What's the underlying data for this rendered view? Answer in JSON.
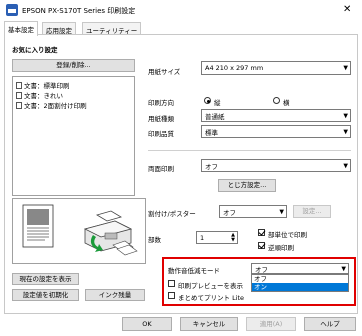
{
  "window": {
    "title": "EPSON PX-S170T Series 印刷設定",
    "close_glyph": "✕"
  },
  "tabs": [
    {
      "label": "基本設定",
      "active": true
    },
    {
      "label": "応用設定",
      "active": false
    },
    {
      "label": "ユーティリティー",
      "active": false
    }
  ],
  "favorites": {
    "heading": "お気に入り設定",
    "register_button": "登録/削除...",
    "items": [
      {
        "label": "文書：標準印刷"
      },
      {
        "label": "文書：きれい"
      },
      {
        "label": "文書：2面割付け印刷"
      }
    ],
    "show_settings_button": "現在の設定を表示",
    "reset_button": "設定値を初期化",
    "ink_button": "インク残量"
  },
  "settings": {
    "paper_size": {
      "label": "用紙サイズ",
      "value": "A4 210 x 297 mm"
    },
    "orientation": {
      "label": "印刷方向",
      "portrait": "縦",
      "landscape": "横",
      "selected": "portrait"
    },
    "paper_type": {
      "label": "用紙種類",
      "value": "普通紙"
    },
    "quality": {
      "label": "印刷品質",
      "value": "標準"
    },
    "duplex": {
      "label": "両面印刷",
      "value": "オフ"
    },
    "binding_button": "とじ方設定...",
    "layout": {
      "label": "割付け/ポスター",
      "value": "オフ",
      "settings_button": "設定..."
    },
    "copies": {
      "label": "部数",
      "value": "1"
    },
    "collate": {
      "label": "部単位で印刷",
      "checked": true
    },
    "reverse": {
      "label": "逆順印刷",
      "checked": true
    },
    "quiet_mode": {
      "label": "動作音低減モード",
      "value": "オフ",
      "options": [
        "オフ",
        "オン"
      ],
      "highlighted_option": "オン"
    },
    "print_preview": {
      "label": "印刷プレビューを表示",
      "checked": false
    },
    "lite": {
      "label": "まとめてプリント Lite",
      "checked": false
    }
  },
  "footer": {
    "ok": "OK",
    "cancel": "キャンセル",
    "apply": "適用(A)",
    "help": "ヘルプ"
  },
  "colors": {
    "highlight_border": "#e00000",
    "selection": "#0078d7"
  }
}
